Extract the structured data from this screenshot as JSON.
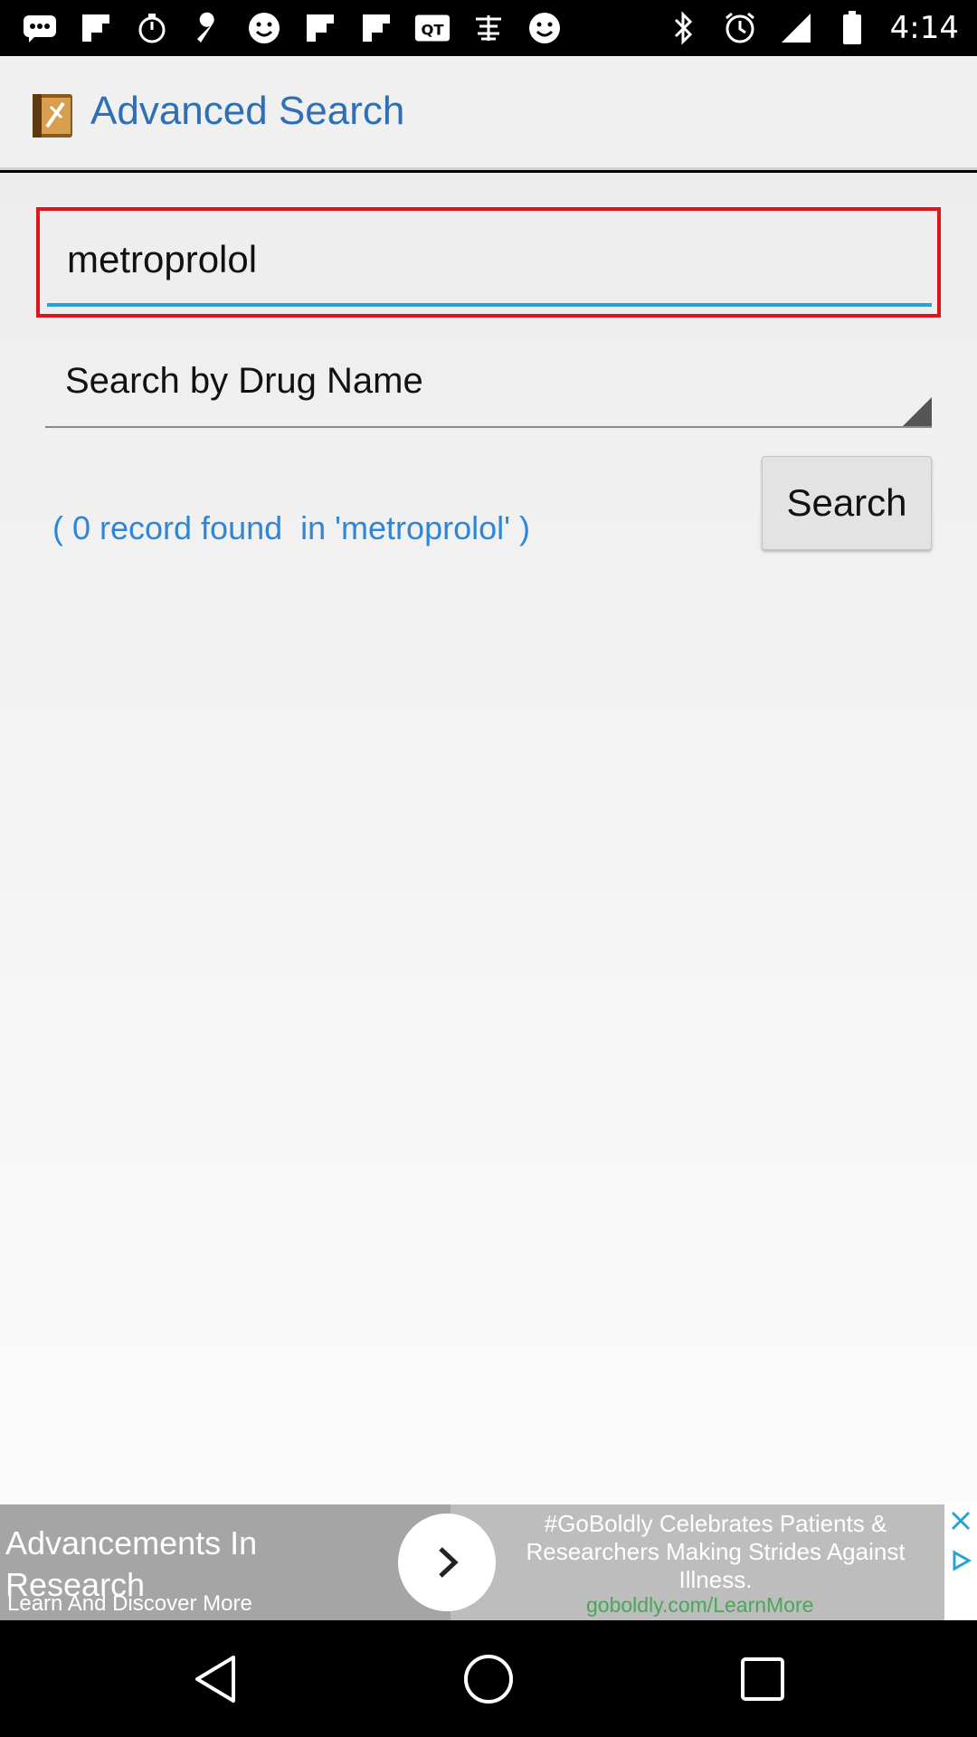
{
  "status_bar": {
    "time": "4:14",
    "icons": [
      "chat-icon",
      "flipboard-icon",
      "timer-icon",
      "wrench-icon",
      "smiley-icon",
      "flipboard-icon",
      "flipboard-icon",
      "qt-icon",
      "chinese-app-icon",
      "smiley-icon",
      "bluetooth-icon",
      "alarm-icon",
      "signal-icon",
      "battery-icon"
    ]
  },
  "app_bar": {
    "title": "Advanced Search",
    "icon": "book-icon"
  },
  "search": {
    "value": "metroprolol",
    "spinner_selected": "Search by Drug Name",
    "button_label": "Search",
    "result_text": "( 0 record found  in 'metroprolol' )"
  },
  "ad": {
    "headline": "Advancements In Research",
    "subtext": "Learn And Discover More",
    "body": "#GoBoldly Celebrates Patients & Researchers Making Strides Against Illness.",
    "url": "goboldly.com/LearnMore"
  },
  "nav": {
    "buttons": [
      "back-icon",
      "home-icon",
      "recents-icon"
    ]
  },
  "colors": {
    "accent": "#2f6fb6",
    "result_text": "#2f86d6",
    "highlight_border": "#e0141c",
    "input_underline": "#2aa0d8"
  }
}
